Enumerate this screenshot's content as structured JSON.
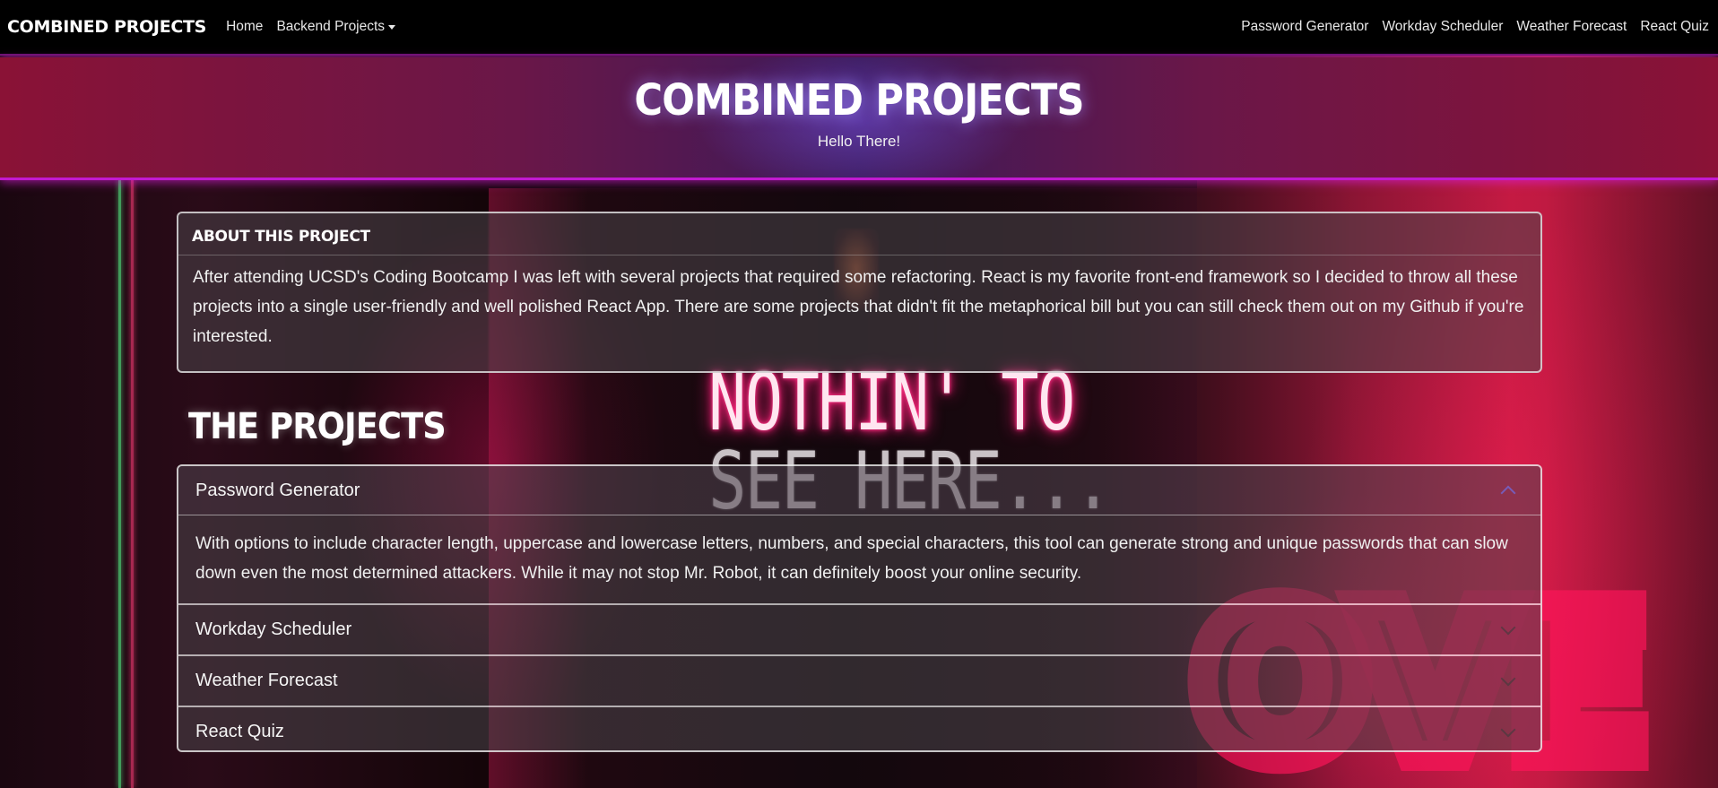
{
  "navbar": {
    "brand": "COMBINED PROJECTS",
    "left": [
      {
        "label": "Home"
      },
      {
        "label": "Backend Projects"
      }
    ],
    "right": [
      {
        "label": "Password Generator"
      },
      {
        "label": "Workday Scheduler"
      },
      {
        "label": "Weather Forecast"
      },
      {
        "label": "React Quiz"
      }
    ]
  },
  "header": {
    "title": "COMBINED PROJECTS",
    "subtitle": "Hello There!"
  },
  "about": {
    "title": "ABOUT THIS PROJECT",
    "text": "After attending UCSD's Coding Bootcamp I was left with several projects that required some refactoring. React is my favorite front-end framework so I decided to throw all these projects into a single user-friendly and well polished React App. There are some projects that didn't fit the metaphorical bill but you can still check them out on my Github if you're interested."
  },
  "background_sign": {
    "line1": "NOTHIN' TO",
    "line2": "SEE HERE..."
  },
  "projects": {
    "title": "THE PROJECTS",
    "items": [
      {
        "label": "Password Generator",
        "open": true,
        "body": "With options to include character length, uppercase and lowercase letters, numbers, and special characters, this tool can generate strong and unique passwords that can slow down even the most determined attackers. While it may not stop Mr. Robot, it can definitely boost your online security."
      },
      {
        "label": "Workday Scheduler",
        "open": false
      },
      {
        "label": "Weather Forecast",
        "open": false
      },
      {
        "label": "React Quiz",
        "open": false
      }
    ]
  },
  "colors": {
    "navbar_bg": "#000000",
    "header_border": "#c21ad0",
    "accent_neon": "#ff1f7a"
  }
}
